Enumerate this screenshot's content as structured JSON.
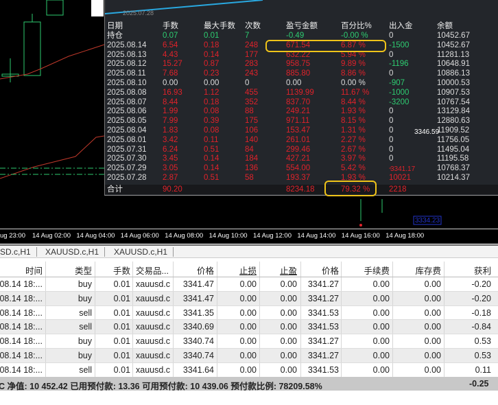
{
  "chart": {
    "mini_date": "2025.07.28",
    "price_label_1": "3346.59",
    "price_label_2": "3341.17",
    "price_label_3": "3334.23",
    "time_axis": [
      "ug 23:00",
      "14 Aug 02:00",
      "14 Aug 04:00",
      "14 Aug 06:00",
      "14 Aug 08:00",
      "14 Aug 10:00",
      "14 Aug 12:00",
      "14 Aug 14:00",
      "14 Aug 16:00",
      "14 Aug 18:00"
    ]
  },
  "stats": {
    "headers": [
      "日期",
      "手数",
      "最大手数",
      "次数",
      "盈亏金额",
      "百分比%",
      "出入金",
      "余额"
    ],
    "rows": [
      [
        "持仓",
        "0.07",
        "0.01",
        "7",
        "-0.49",
        "-0.00 %",
        "0",
        "10452.67"
      ],
      [
        "2025.08.14",
        "6.54",
        "0.18",
        "248",
        "671.54",
        "6.87 %",
        "-1500",
        "10452.67"
      ],
      [
        "2025.08.13",
        "4.43",
        "0.14",
        "177",
        "632.22",
        "5.94 %",
        "0",
        "11281.13"
      ],
      [
        "2025.08.12",
        "15.27",
        "0.87",
        "283",
        "958.75",
        "9.89 %",
        "-1196",
        "10648.91"
      ],
      [
        "2025.08.11",
        "7.68",
        "0.23",
        "243",
        "885.80",
        "8.86 %",
        "0",
        "10886.13"
      ],
      [
        "2025.08.10",
        "0.00",
        "0.00",
        "0",
        "0.00",
        "0.00 %",
        "-907",
        "10000.53"
      ],
      [
        "2025.08.08",
        "16.93",
        "1.12",
        "455",
        "1139.99",
        "11.67 %",
        "-1000",
        "10907.53"
      ],
      [
        "2025.08.07",
        "8.44",
        "0.18",
        "352",
        "837.70",
        "8.44 %",
        "-3200",
        "10767.54"
      ],
      [
        "2025.08.06",
        "1.99",
        "0.08",
        "88",
        "249.21",
        "1.93 %",
        "0",
        "13129.84"
      ],
      [
        "2025.08.05",
        "7.99",
        "0.39",
        "175",
        "971.11",
        "8.15 %",
        "0",
        "12880.63"
      ],
      [
        "2025.08.04",
        "1.83",
        "0.08",
        "106",
        "153.47",
        "1.31 %",
        "0",
        "11909.52"
      ],
      [
        "2025.08.01",
        "3.42",
        "0.11",
        "140",
        "261.01",
        "2.27 %",
        "0",
        "11756.05"
      ],
      [
        "2025.07.31",
        "6.24",
        "0.51",
        "84",
        "299.46",
        "2.67 %",
        "0",
        "11495.04"
      ],
      [
        "2025.07.30",
        "3.45",
        "0.14",
        "184",
        "427.21",
        "3.97 %",
        "0",
        "11195.58"
      ],
      [
        "2025.07.29",
        "3.05",
        "0.14",
        "136",
        "554.00",
        "5.42 %",
        "-",
        "10768.37"
      ],
      [
        "2025.07.28",
        "2.87",
        "0.51",
        "58",
        "193.37",
        "1.93 %",
        "10021",
        "10214.37"
      ]
    ],
    "total": [
      "合计",
      "90.20",
      "",
      "",
      "8234.18",
      "79.32 %",
      "2218",
      ""
    ]
  },
  "tabs": [
    "SD.c,H1",
    "XAUUSD.c,H1",
    "XAUUSD.c,H1"
  ],
  "orders": {
    "headers": [
      "时间",
      "类型",
      "手数",
      "交易品...",
      "价格",
      "止损",
      "止盈",
      "价格",
      "手续费",
      "库存费",
      "获利"
    ],
    "rows": [
      [
        "08.14 18:...",
        "buy",
        "0.01",
        "xauusd.c",
        "3341.47",
        "0.00",
        "0.00",
        "3341.27",
        "0.00",
        "0.00",
        "-0.20"
      ],
      [
        "08.14 18:...",
        "buy",
        "0.01",
        "xauusd.c",
        "3341.47",
        "0.00",
        "0.00",
        "3341.27",
        "0.00",
        "0.00",
        "-0.20"
      ],
      [
        "08.14 18:...",
        "sell",
        "0.01",
        "xauusd.c",
        "3341.35",
        "0.00",
        "0.00",
        "3341.53",
        "0.00",
        "0.00",
        "-0.18"
      ],
      [
        "08.14 18:...",
        "sell",
        "0.01",
        "xauusd.c",
        "3340.69",
        "0.00",
        "0.00",
        "3341.53",
        "0.00",
        "0.00",
        "-0.84"
      ],
      [
        "08.14 18:...",
        "buy",
        "0.01",
        "xauusd.c",
        "3340.74",
        "0.00",
        "0.00",
        "3341.27",
        "0.00",
        "0.00",
        "0.53"
      ],
      [
        "08.14 18:...",
        "buy",
        "0.01",
        "xauusd.c",
        "3340.74",
        "0.00",
        "0.00",
        "3341.27",
        "0.00",
        "0.00",
        "0.53"
      ],
      [
        "08.14 18:...",
        "sell",
        "0.01",
        "xauusd.c",
        "3341.64",
        "0.00",
        "0.00",
        "3341.53",
        "0.00",
        "0.00",
        "0.11"
      ]
    ]
  },
  "footer": {
    "text": "C  净值: 10 452.42  已用预付款: 13.36  可用预付款: 10 439.06  预付款比例: 78209.58%",
    "total": "-0.25"
  }
}
